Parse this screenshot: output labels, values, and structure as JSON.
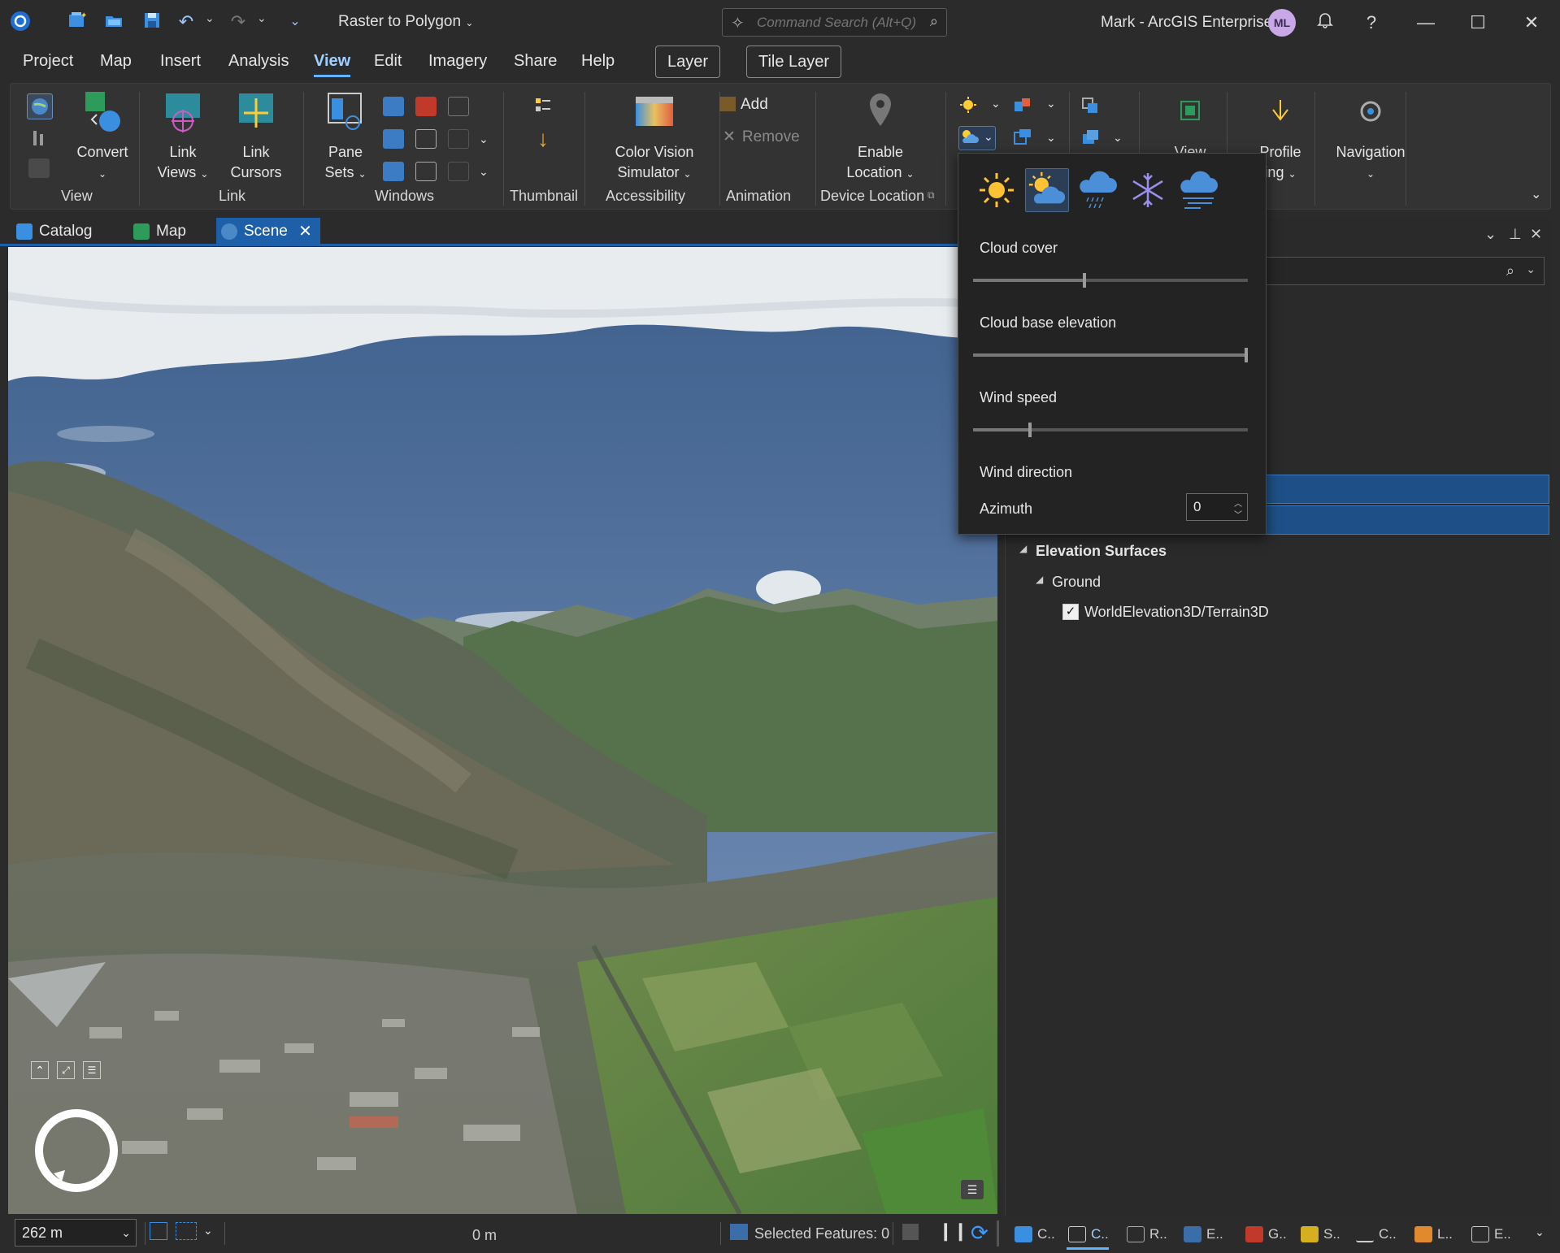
{
  "titlebar": {
    "project_template": "Raster to Polygon",
    "search_placeholder": "Command Search (Alt+Q)",
    "user": "Mark - ArcGIS Enterprise",
    "avatar_initials": "ML"
  },
  "menu": {
    "items": [
      "Project",
      "Map",
      "Insert",
      "Analysis",
      "View",
      "Edit",
      "Imagery",
      "Share",
      "Help"
    ],
    "active": "View",
    "contextual_tabs": [
      "Layer",
      "Tile Layer"
    ]
  },
  "ribbon": {
    "view_group": {
      "label": "View",
      "convert": "Convert"
    },
    "link_group": {
      "label": "Link",
      "link_views_1": "Link",
      "link_views_2": "Views",
      "link_cursors_1": "Link",
      "link_cursors_2": "Cursors"
    },
    "windows_group": {
      "label": "Windows",
      "pane_sets_1": "Pane",
      "pane_sets_2": "Sets"
    },
    "thumbnail_group": {
      "label": "Thumbnail"
    },
    "accessibility_group": {
      "label": "Accessibility",
      "cvs_1": "Color Vision",
      "cvs_2": "Simulator"
    },
    "animation_group": {
      "label": "Animation",
      "add": "Add",
      "remove": "Remove"
    },
    "device_group": {
      "label": "Device Location",
      "enable_1": "Enable",
      "enable_2": "Location"
    },
    "view_btn": "View",
    "profile_1": "Profile",
    "profile_2": "ing",
    "navigation": "Navigation"
  },
  "doc_tabs": [
    "Catalog",
    "Map",
    "Scene"
  ],
  "weather_popup": {
    "cloud_cover_label": "Cloud cover",
    "cloud_cover_value": 0.4,
    "cloud_base_label": "Cloud base elevation",
    "cloud_base_value": 1.0,
    "wind_speed_label": "Wind speed",
    "wind_speed_value": 0.2,
    "wind_direction_label": "Wind direction",
    "azimuth_label": "Azimuth",
    "azimuth_value": "0"
  },
  "contents": {
    "elevation_surfaces": "Elevation Surfaces",
    "ground": "Ground",
    "layer": "WorldElevation3D/Terrain3D"
  },
  "statusbar": {
    "scale": "262 m",
    "distance": "0 m",
    "selected_features": "Selected Features: 0",
    "bottom_tabs": [
      "C..",
      "C..",
      "R..",
      "E..",
      "G..",
      "S..",
      "C..",
      "L..",
      "E.."
    ]
  },
  "colors": {
    "accent": "#1d5fa8",
    "selection": "#1e4f86"
  }
}
